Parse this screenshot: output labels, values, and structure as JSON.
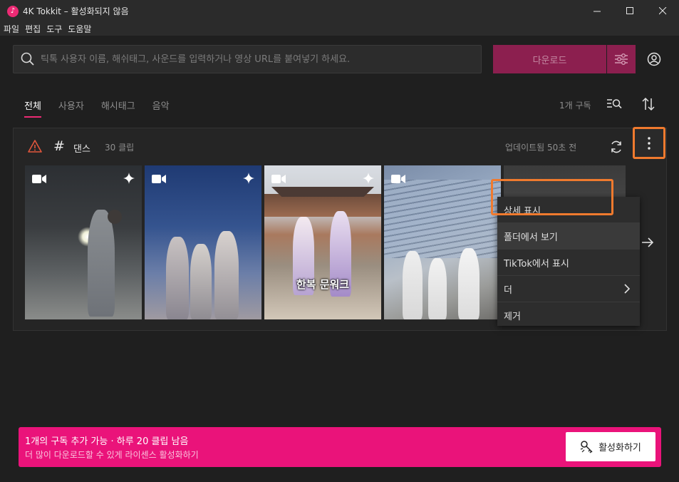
{
  "window": {
    "title": "4K Tokkit – 활성화되지 않음",
    "minimize": "—",
    "maximize": "☐",
    "close": "✕"
  },
  "menu": [
    "파일",
    "편집",
    "도구",
    "도움말"
  ],
  "search": {
    "placeholder": "틱톡 사용자 이름, 해쉬태그, 사운드를 입력하거나 영상 URL를 붙여넣기 하세요."
  },
  "download_label": "다운로드",
  "tabs": [
    "전체",
    "사용자",
    "해시태그",
    "음악"
  ],
  "subscription_count": "1개 구독",
  "card": {
    "title": "댄스",
    "clip_count": "30 클립",
    "updated": "업데이트됨 50초 전",
    "thumbnail_caption": "한복 문워크"
  },
  "context_menu": [
    {
      "label": "상세 표시"
    },
    {
      "label": "폴더에서 보기"
    },
    {
      "label": "TikTok에서 표시"
    },
    {
      "label": "더"
    },
    {
      "label": "제거"
    }
  ],
  "banner": {
    "line1": "1개의 구독 추가 가능 · 하루 20 클립 남음",
    "line2": "더 많이 다운로드할 수 있게 라이센스 활성화하기",
    "activate_label": "활성화하기"
  },
  "colors": {
    "accent": "#ec2a74",
    "banner": "#ea137a",
    "download_disabled": "#8c1f4f",
    "highlight": "#f07a2e"
  }
}
